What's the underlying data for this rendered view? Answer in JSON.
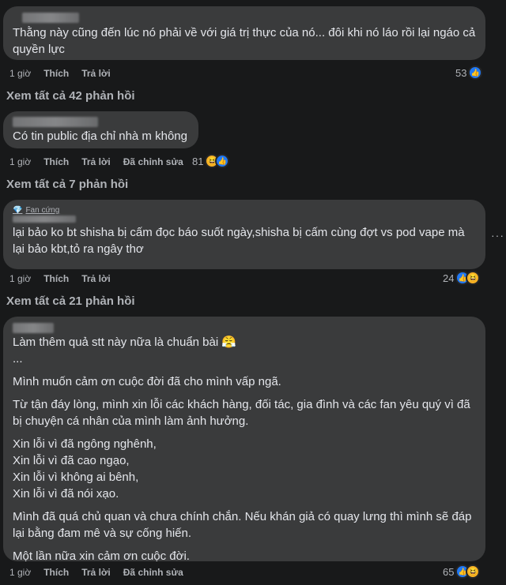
{
  "comments": [
    {
      "text": "Thằng này cũng đến lúc nó phải về với giá trị thực của nó... đôi khi nó láo rồi lại ngáo cả quyền lực",
      "time": "1 giờ",
      "like": "Thích",
      "reply": "Trả lời",
      "edited": "",
      "count": "53",
      "reactions": [
        "like"
      ],
      "view_replies": "Xem tất cả 42 phản hồi"
    },
    {
      "text": "Có tin public địa chỉ nhà m không",
      "time": "1 giờ",
      "like": "Thích",
      "reply": "Trả lời",
      "edited": "Đã chỉnh sửa",
      "count": "81",
      "reactions": [
        "haha",
        "like"
      ],
      "view_replies": "Xem tất cả 7 phản hồi"
    },
    {
      "badge": "Fan cứng",
      "text": "lại bảo ko bt shisha bị cấm đọc báo suốt ngày,shisha bị cấm cùng đợt vs pod vape mà lại bảo kbt,tỏ ra ngây thơ",
      "time": "1 giờ",
      "like": "Thích",
      "reply": "Trả lời",
      "edited": "",
      "count": "24",
      "reactions": [
        "like",
        "haha"
      ],
      "view_replies": "Xem tất cả 21 phản hồi"
    },
    {
      "text": "Làm thêm quả stt này nữa là chuẩn bài 😤\n...\nMình muốn cảm ơn cuộc đời đã cho mình vấp ngã.\nTừ tận đáy lòng, mình xin lỗi các khách hàng, đối tác, gia đình và các fan yêu quý vì đã bị chuyện cá nhân của mình làm ảnh hưởng.\nXin lỗi vì đã ngông nghênh,\nXin lỗi vì đã cao ngạo,\nXin lỗi vì không ai bênh,\nXin lỗi vì đã nói xạo.\nMình đã quá chủ quan và chưa chính chắn. Nếu khán giả có quay lưng thì mình sẽ đáp lại bằng đam mê và sự cống hiến.\nMột lần nữa xin cảm ơn cuộc đời.",
      "time": "1 giờ",
      "like": "Thích",
      "reply": "Trả lời",
      "edited": "Đã chỉnh sửa",
      "count": "65",
      "reactions": [
        "like",
        "haha"
      ]
    }
  ],
  "more_icon": "···"
}
